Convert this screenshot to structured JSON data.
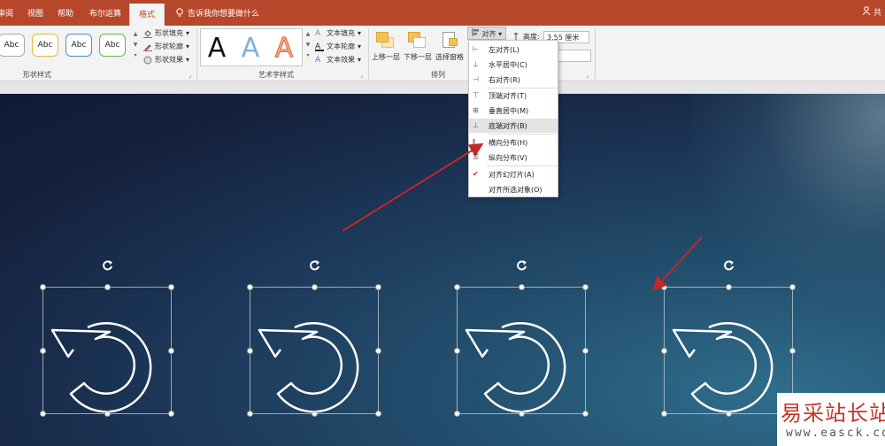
{
  "tabs": [
    "审阅",
    "视图",
    "帮助",
    "布尔运算"
  ],
  "active_tab": "格式",
  "tell_me": "告诉我你想要做什么",
  "user_fragment": "共",
  "shape_styles": {
    "samples": [
      "Abc",
      "Abc",
      "Abc",
      "Abc"
    ],
    "fill": "形状填充",
    "outline": "形状轮廓",
    "effect": "形状效果",
    "group": "形状样式"
  },
  "wordart": {
    "letters": [
      "A",
      "A",
      "A"
    ],
    "text_fill": "文本填充",
    "text_outline": "文本轮廓",
    "text_effect": "文本效果",
    "group": "艺术字样式"
  },
  "arrange": {
    "bring_forward": "上移一层",
    "send_backward": "下移一层",
    "selection_pane": "选择窗格",
    "align": "对齐",
    "group": "排列"
  },
  "size": {
    "height_label": "高度:",
    "height_value": "3.55 厘米"
  },
  "align_menu": [
    "左对齐(L)",
    "水平居中(C)",
    "右对齐(R)",
    "顶端对齐(T)",
    "垂直居中(M)",
    "底端对齐(B)",
    "横向分布(H)",
    "纵向分布(V)",
    "对齐幻灯片(A)",
    "对齐所选对象(O)"
  ],
  "colors": {
    "accent": "#b7472a",
    "slide_dark": "#15223f",
    "slide_light": "#2f6e8c",
    "arrow": "#c0282a"
  },
  "watermark": {
    "title": "易采站长站",
    "url": "www.easck.com"
  }
}
